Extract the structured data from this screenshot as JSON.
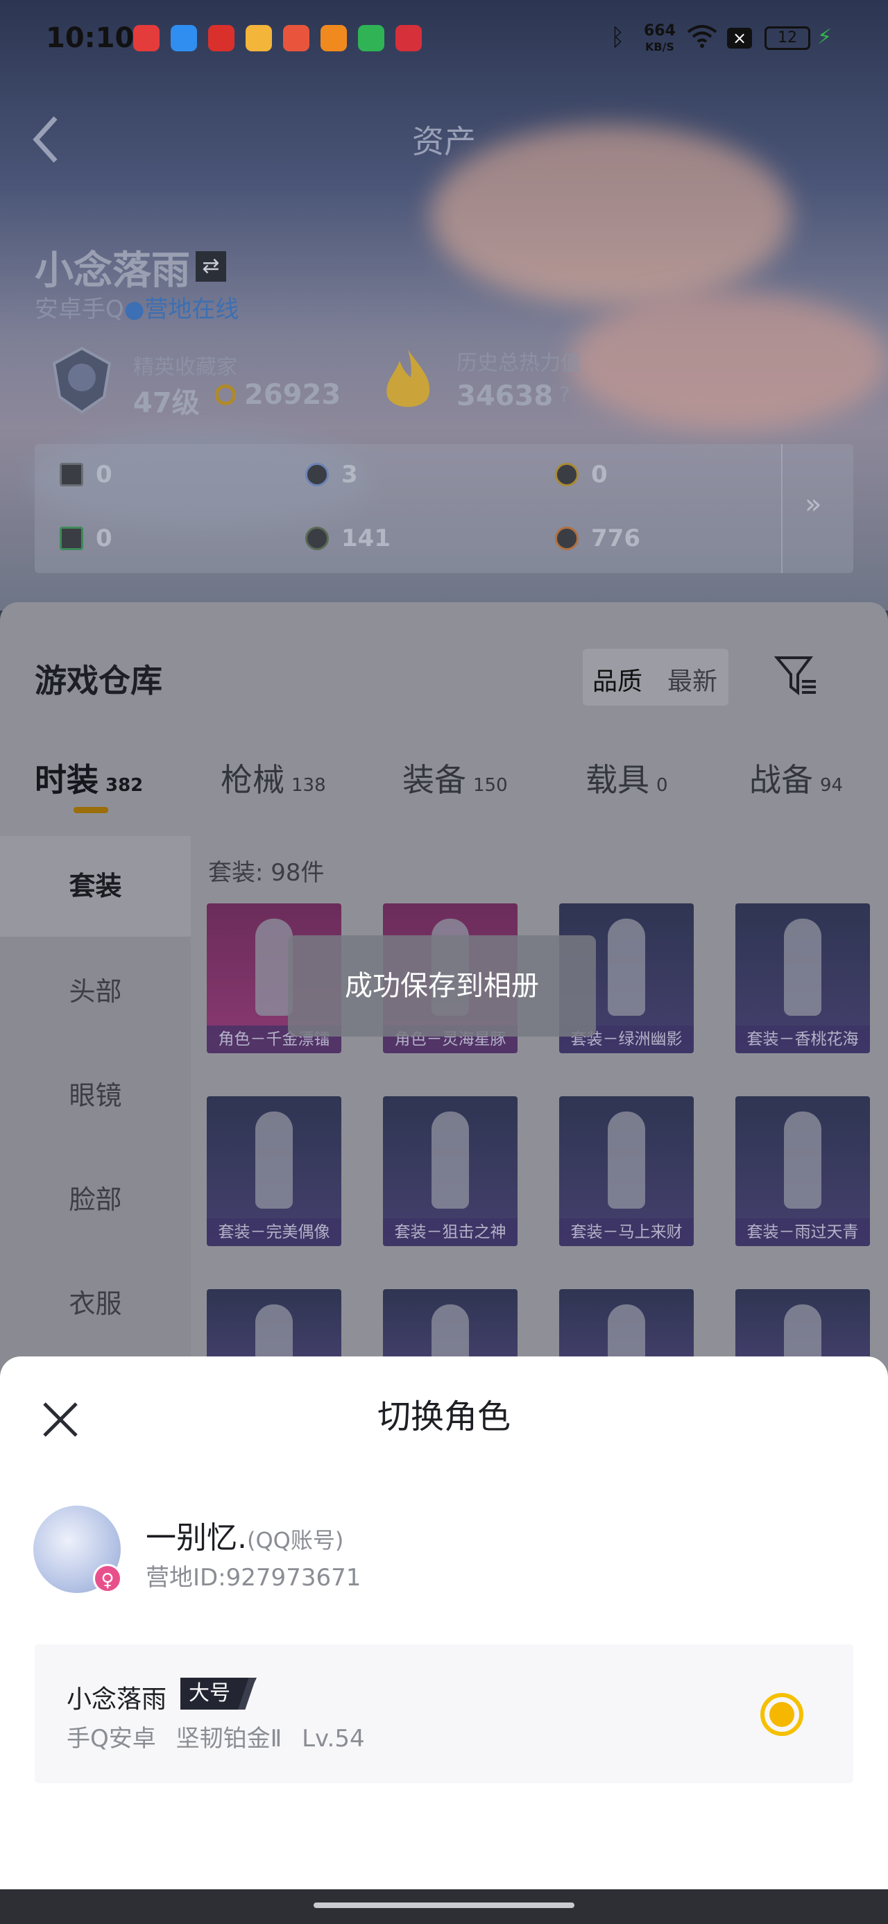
{
  "status_bar": {
    "time": "10:10",
    "network_speed": "664",
    "network_unit": "KB/S",
    "battery": "12"
  },
  "header": {
    "title": "资产"
  },
  "player": {
    "name": "小念落雨",
    "platform": "安卓手Q",
    "online_status": "营地在线",
    "collector_label": "精英收藏家",
    "level": "47级",
    "coins": "26923",
    "heat_label": "历史总热力值",
    "heat_value": "34638",
    "heat_help": "?"
  },
  "assets": {
    "a1": "0",
    "a2": "3",
    "a3": "0",
    "a4": "0",
    "a5": "141",
    "a6": "776",
    "more": "»"
  },
  "warehouse": {
    "title": "游戏仓库",
    "sort_quality": "品质",
    "sort_latest": "最新"
  },
  "tabs": [
    {
      "label": "时装",
      "count": "382"
    },
    {
      "label": "枪械",
      "count": "138"
    },
    {
      "label": "装备",
      "count": "150"
    },
    {
      "label": "载具",
      "count": "0"
    },
    {
      "label": "战备",
      "count": "94"
    }
  ],
  "left_nav": [
    "套装",
    "头部",
    "眼镜",
    "脸部",
    "衣服"
  ],
  "item_count": "套装: 98件",
  "items": [
    "角色－千金漂镭",
    "角色－灵海星豚",
    "套装－绿洲幽影",
    "套装－香桃花海",
    "套装－完美偶像",
    "套装－狙击之神",
    "套装－马上来财",
    "套装－雨过天青"
  ],
  "toast": "成功保存到相册",
  "modal": {
    "title": "切换角色",
    "user_name": "一别忆.",
    "account_type": "(QQ账号)",
    "camp_id": "营地ID:927973671",
    "role_name": "小念落雨",
    "role_badge": "大号",
    "role_info": "手Q安卓 坚韧铂金Ⅱ Lv.54"
  },
  "colors": {
    "accent": "#f5c000",
    "tab_underline": "#9b6e0a",
    "online": "#3c6fb3"
  }
}
